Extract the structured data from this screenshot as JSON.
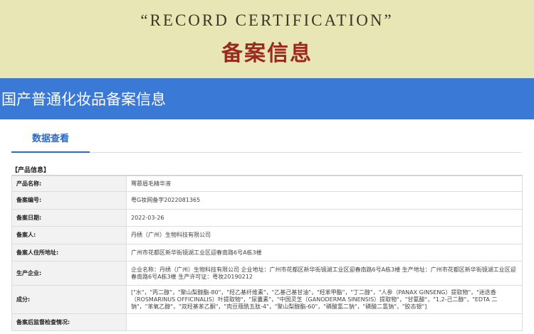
{
  "banner": {
    "english_title": "“RECORD CERTIFICATION”",
    "chinese_title": "备案信息"
  },
  "page": {
    "title": "国产普通化妆品备案信息"
  },
  "tabs": [
    {
      "label": "数据查看",
      "active": true
    }
  ],
  "section": {
    "title": "【产品信息】"
  },
  "rows": [
    {
      "label": "产品名称:",
      "value": "骞慕眉毛精华液"
    },
    {
      "label": "备案编号:",
      "value": "粤G妆网备字2022081365"
    },
    {
      "label": "备案日期:",
      "value": "2022-03-26"
    },
    {
      "label": "备案人:",
      "value": "丹绣（广州）生物科技有限公司"
    },
    {
      "label": "备案人住所地址:",
      "value": "广州市花都区新华街镜湖工业区迎春南路6号A栋3楼"
    },
    {
      "label": "生产企业:",
      "value": "企业名称：丹绣（广州）生物科技有限公司 企业地址：广州市花都区新华街镜湖工业区迎春南路6号A栋3楼 生产地址：广州市花都区新华街镜湖工业区迎春南路6号A栋3楼 生产许可证：粤妆20190212"
    },
    {
      "label": "成分:",
      "value": "[\"水\"，\"丙二醇\"，\"聚山梨醇酯-80\"，\"羟乙基纤维素\"，\"乙基己基甘油\"，\"羟苯甲酯\"，\"丁二醇\"，\"人参（PANAX GINSENG）提取物\"，\"迷迭香（ROSMARINUS OFFICINALIS）叶提取物\"，\"尿囊素\"，\"中国灵芝（GANODERMA SINENSIS）提取物\"，\"甘氨酸\"，\"1,2-己二醇\"，\"EDTA 二钠\"，\"苯氧乙醇\"，\"双羟基苯乙酮\"，\"肉豆蔻酰五肽-4\"，\"聚山梨醇酯-60\"，\"磷酸氢二钠\"，\"磷酸二氢钠\"，\"胶态银\"]"
    },
    {
      "label": "备案后监督检查情况:",
      "value": ""
    }
  ],
  "colors": {
    "banner_bg": "#e8e6b5",
    "banner_title_red": "#9a2a1f",
    "header_blue": "#3a79d6",
    "tab_blue": "#2d6bc6",
    "label_bg": "#f2f2f2"
  }
}
